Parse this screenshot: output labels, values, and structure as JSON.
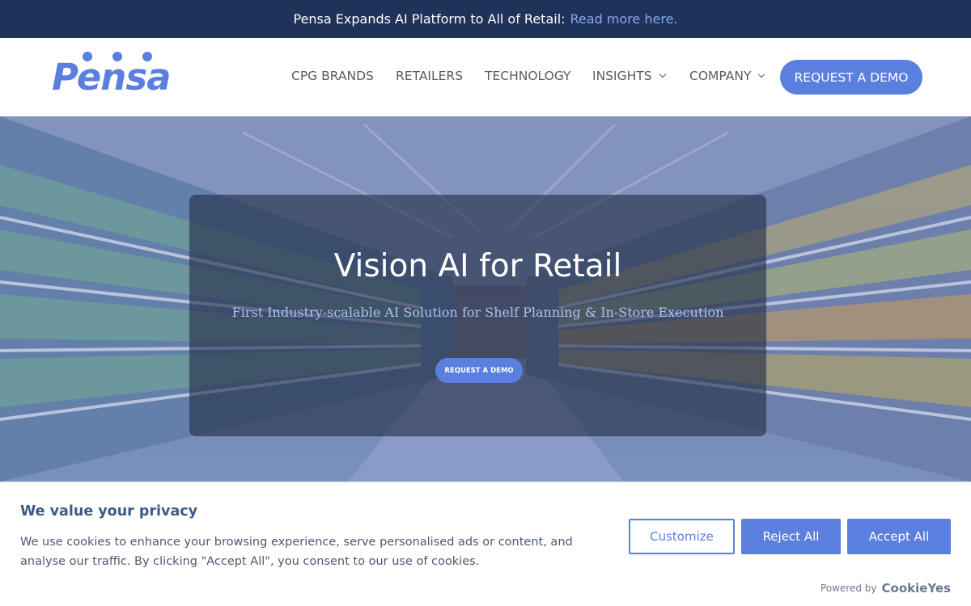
{
  "announcement": {
    "text": "Pensa Expands AI Platform to All of Retail:",
    "link": "Read more here."
  },
  "header": {
    "logo_text": "Pensa",
    "nav": [
      {
        "label": "CPG BRANDS",
        "has_dropdown": false
      },
      {
        "label": "RETAILERS",
        "has_dropdown": false
      },
      {
        "label": "TECHNOLOGY",
        "has_dropdown": false
      },
      {
        "label": "INSIGHTS",
        "has_dropdown": true
      },
      {
        "label": "COMPANY",
        "has_dropdown": true
      }
    ],
    "cta": "REQUEST A DEMO"
  },
  "hero": {
    "title": "Vision AI for Retail",
    "subtitle": "First Industry-scalable AI Solution for Shelf Planning & In-Store Execution",
    "cta": "REQUEST A DEMO"
  },
  "cookie_banner": {
    "title": "We value your privacy",
    "text": "We use cookies to enhance your browsing experience, serve personalised ads or content, and analyse our traffic. By clicking \"Accept All\", you consent to our use of cookies.",
    "buttons": {
      "customize": "Customize",
      "reject": "Reject All",
      "accept": "Accept All"
    },
    "powered_by": "Powered by",
    "powered_brand": "CookieYes"
  },
  "colors": {
    "accent": "#5b7fdf",
    "announcement_bg": "#1f3358",
    "nav_text": "#555c66",
    "cookie_title": "#3e5a86"
  },
  "icons": [
    "chevron-down-icon"
  ]
}
